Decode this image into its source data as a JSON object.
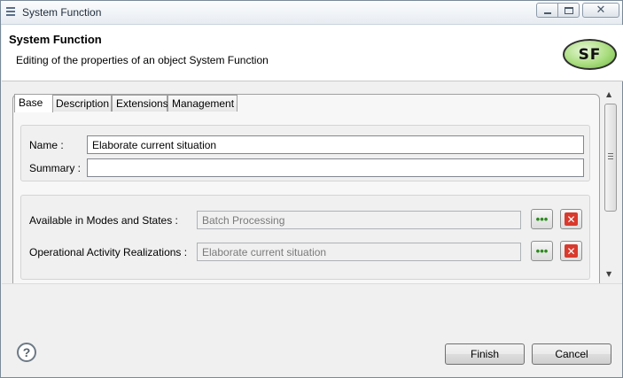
{
  "window": {
    "title": "System Function"
  },
  "header": {
    "title": "System Function",
    "description": "Editing of the properties of an object System Function",
    "logo_text": "SF"
  },
  "tabs": [
    {
      "label": "Base",
      "active": true
    },
    {
      "label": "Description",
      "active": false
    },
    {
      "label": "Extensions",
      "active": false
    },
    {
      "label": "Management",
      "active": false
    }
  ],
  "fields": {
    "name": {
      "label": "Name :",
      "value": "Elaborate current situation"
    },
    "summary": {
      "label": "Summary :",
      "value": ""
    },
    "modes_states": {
      "label": "Available in Modes and States :",
      "value": "Batch Processing"
    },
    "op_activity": {
      "label": "Operational Activity Realizations :",
      "value": "Elaborate current situation"
    }
  },
  "buttons": {
    "browse_glyph": "•••",
    "remove_glyph": "✕",
    "finish": "Finish",
    "cancel": "Cancel",
    "help_glyph": "?"
  },
  "icons": {
    "browse": "ellipsis-icon",
    "remove": "red-x-icon",
    "help": "question-mark-icon"
  },
  "colors": {
    "accent_green": "#2d8a1e",
    "remove_red": "#d83a2d",
    "logo_green": "#a9dd7e"
  }
}
